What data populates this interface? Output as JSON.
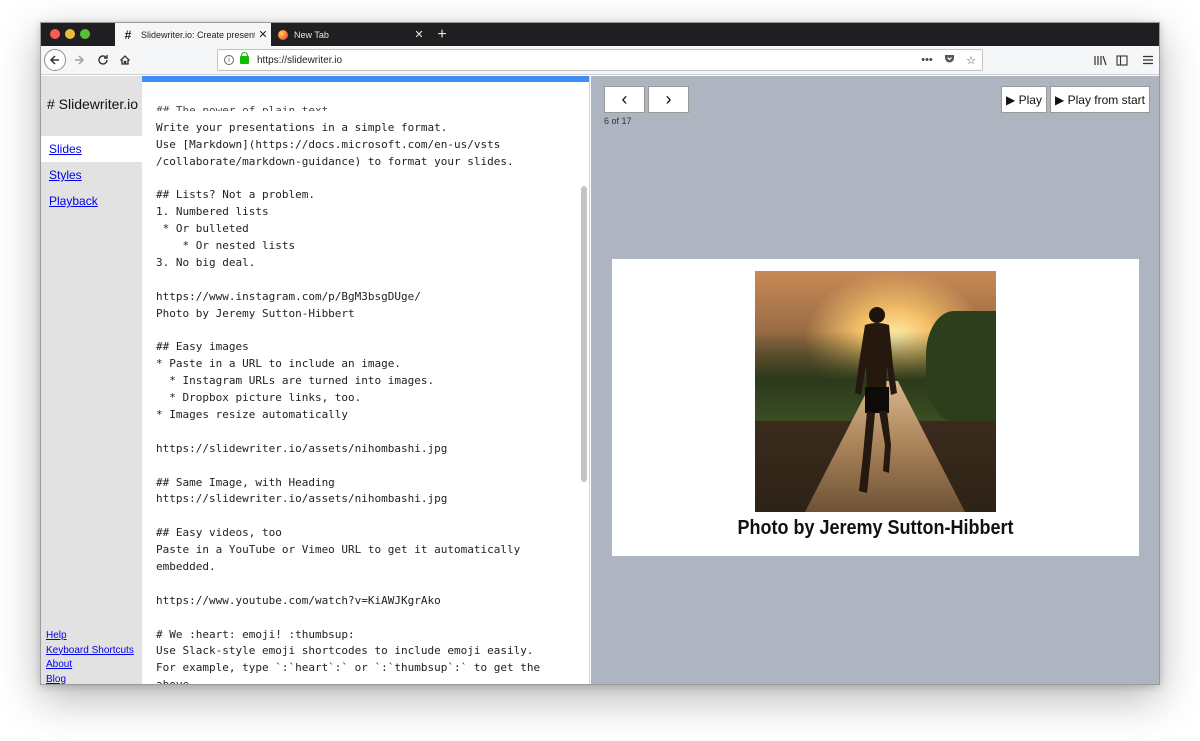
{
  "browser": {
    "tabs": [
      {
        "label": "Slidewriter.io: Create presentati",
        "favicon": "#",
        "active": true
      },
      {
        "label": "New Tab",
        "favicon": "firefox-icon",
        "active": false
      }
    ],
    "close_glyph": "✕",
    "new_tab_glyph": "+",
    "url": "https://slidewriter.io",
    "url_actions": [
      "•••",
      "pocket-icon",
      "bookmark-star-icon"
    ],
    "toolbar_icons": [
      "library-icon",
      "sidebar-icon",
      "menu-icon"
    ]
  },
  "sidebar": {
    "brand": "# Slidewriter.io",
    "nav": [
      {
        "label": "Slides",
        "active": true
      },
      {
        "label": "Styles",
        "active": false
      },
      {
        "label": "Playback",
        "active": false
      }
    ],
    "footer": [
      "Help",
      "Keyboard Shortcuts",
      "About",
      "Blog"
    ]
  },
  "editor": {
    "top_fragment": "## The power of plain text.",
    "lines": [
      "Write your presentations in a simple format.",
      "Use [Markdown](https://docs.microsoft.com/en-us/vsts",
      "/collaborate/markdown-guidance) to format your slides.",
      "",
      "## Lists? Not a problem.",
      "1. Numbered lists",
      " * Or bulleted",
      "    * Or nested lists",
      "3. No big deal.",
      "",
      "https://www.instagram.com/p/BgM3bsgDUge/",
      "Photo by Jeremy Sutton-Hibbert",
      "",
      "## Easy images",
      "* Paste in a URL to include an image.",
      "  * Instagram URLs are turned into images.",
      "  * Dropbox picture links, too.",
      "* Images resize automatically",
      "",
      "https://slidewriter.io/assets/nihombashi.jpg",
      "",
      "## Same Image, with Heading",
      "https://slidewriter.io/assets/nihombashi.jpg",
      "",
      "## Easy videos, too",
      "Paste in a YouTube or Vimeo URL to get it automatically",
      "embedded.",
      "",
      "https://www.youtube.com/watch?v=KiAWJKgrAko",
      "",
      "# We :heart: emoji! :thumbsup:",
      "Use Slack-style emoji shortcodes to include emoji easily.",
      "For example, type `:`heart`:` or `:`thumbsup`:` to get the",
      "above."
    ]
  },
  "preview": {
    "prev_label": "‹",
    "next_label": "›",
    "play_label": "▶ Play",
    "play_from_start_label": "▶ Play from start",
    "counter": "6 of 17",
    "slide_caption": "Photo by Jeremy Sutton-Hibbert"
  },
  "colors": {
    "progress_bar": "#3d8ef5",
    "preview_bg": "#aeb4c0",
    "sidebar_bg": "#e2e2e2",
    "link": "#0000ee"
  }
}
